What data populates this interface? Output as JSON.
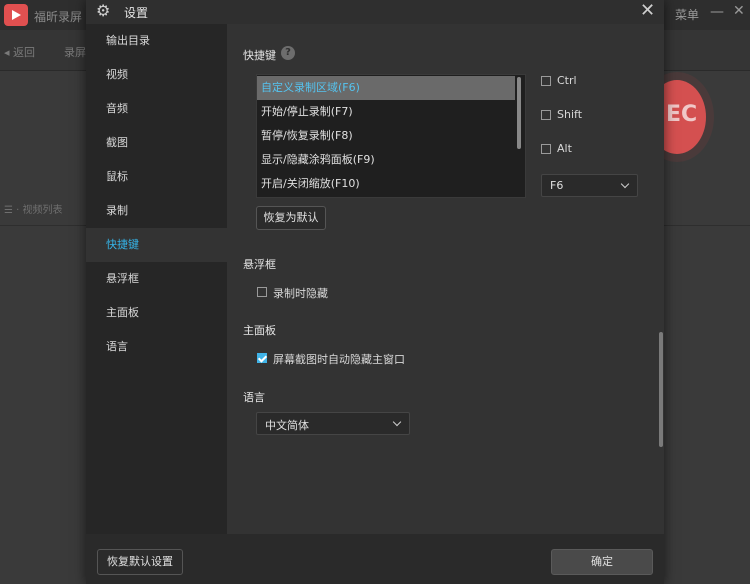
{
  "background_app": {
    "title": "福昕录屏",
    "menu_label": "菜单",
    "back_label": "返回",
    "record_label": "录屏",
    "list_label": "视频列表",
    "rec_text": "EC",
    "minimize_glyph": "—",
    "close_glyph": "✕"
  },
  "dialog": {
    "title": "设置",
    "close_glyph": "✕",
    "gear_glyph": "⚙"
  },
  "sidebar": {
    "items": [
      {
        "label": "输出目录"
      },
      {
        "label": "视频"
      },
      {
        "label": "音频"
      },
      {
        "label": "截图"
      },
      {
        "label": "鼠标"
      },
      {
        "label": "录制"
      },
      {
        "label": "快捷键",
        "active": true
      },
      {
        "label": "悬浮框"
      },
      {
        "label": "主面板"
      },
      {
        "label": "语言"
      }
    ]
  },
  "hotkeys": {
    "section_title": "快捷键",
    "help_glyph": "?",
    "items": [
      {
        "label": "自定义录制区域(F6)",
        "selected": true
      },
      {
        "label": "开始/停止录制(F7)"
      },
      {
        "label": "暂停/恢复录制(F8)"
      },
      {
        "label": "显示/隐藏涂鸦面板(F9)"
      },
      {
        "label": "开启/关闭缩放(F10)"
      }
    ],
    "modifiers": [
      {
        "label": "Ctrl",
        "checked": false
      },
      {
        "label": "Shift",
        "checked": false
      },
      {
        "label": "Alt",
        "checked": false
      }
    ],
    "key_select": {
      "value": "F6"
    },
    "restore_default_label": "恢复为默认"
  },
  "floating": {
    "section_title": "悬浮框",
    "hide_while_recording": {
      "label": "录制时隐藏",
      "checked": false
    }
  },
  "main_panel": {
    "section_title": "主面板",
    "auto_hide_on_screenshot": {
      "label": "屏幕截图时自动隐藏主窗口",
      "checked": true
    }
  },
  "language": {
    "section_title": "语言",
    "select": {
      "value": "中文简体"
    }
  },
  "footer": {
    "restore_all_label": "恢复默认设置",
    "confirm_label": "确定"
  },
  "colors": {
    "accent": "#35b4e8",
    "dialog_bg": "#2f2f2f",
    "content_bg": "#333333",
    "sidebar_bg": "#262626",
    "record_red": "#d45050"
  }
}
